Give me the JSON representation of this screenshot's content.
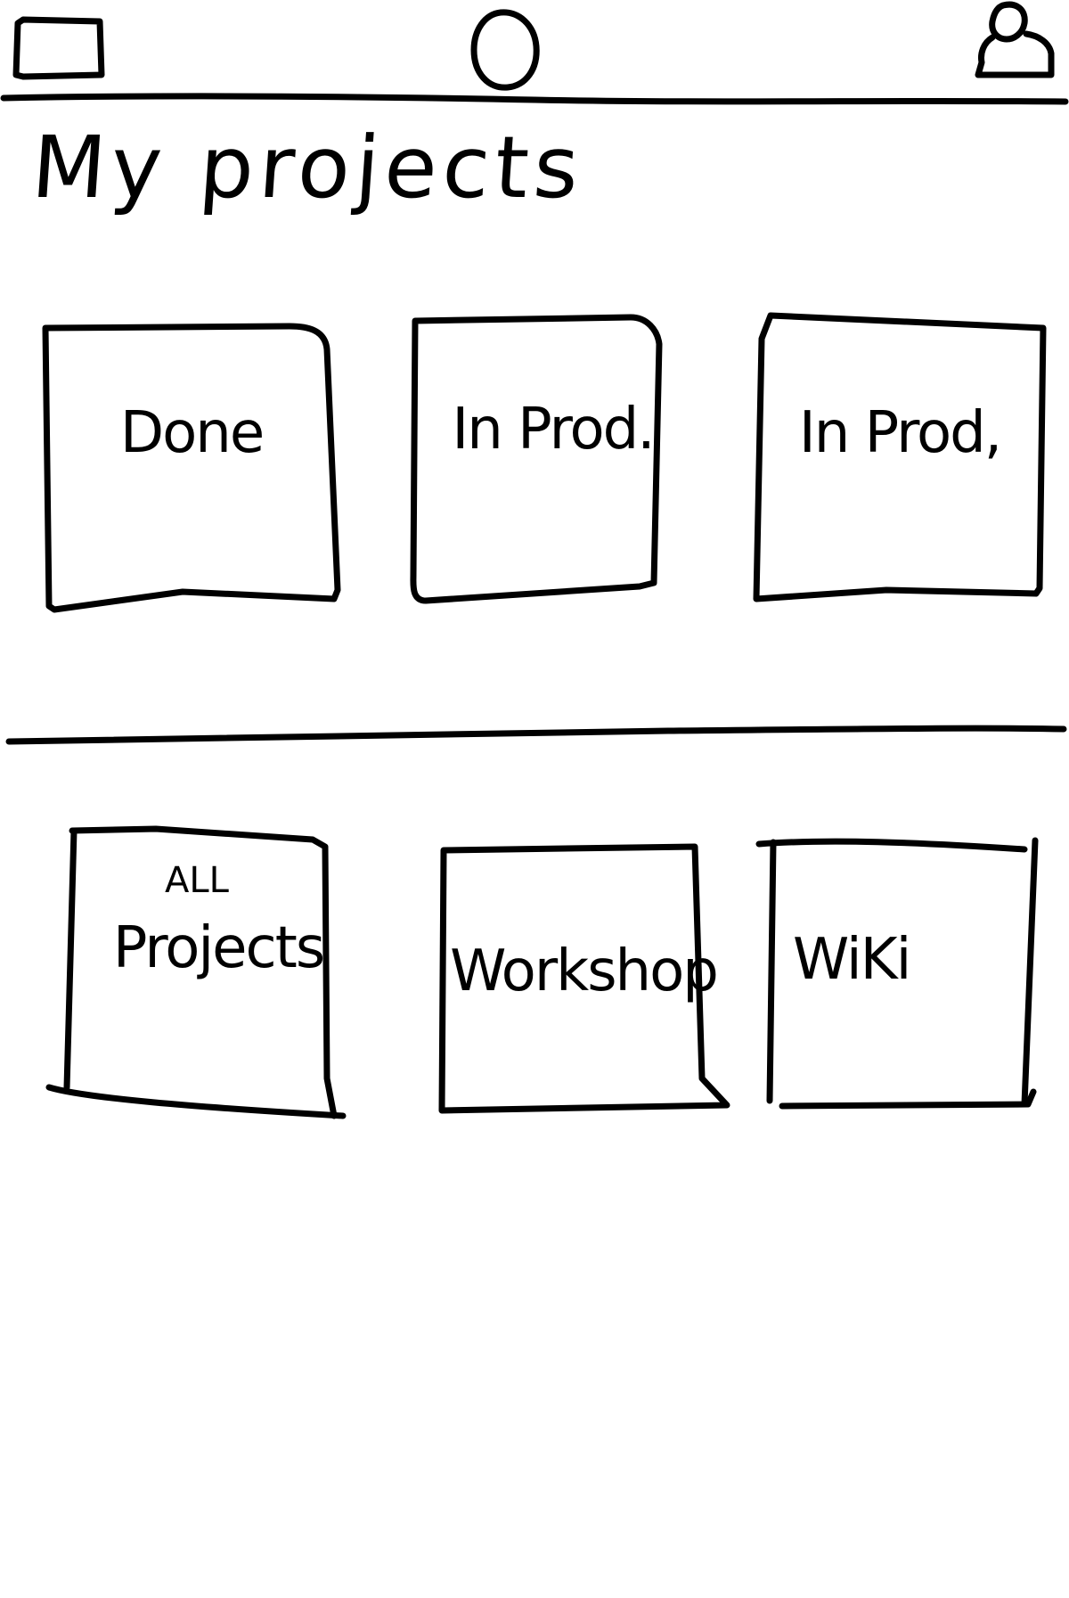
{
  "header": {
    "menu_icon": "rectangle-menu-icon",
    "home_icon": "circle-home-icon",
    "profile_icon": "user-profile-icon"
  },
  "page_title": "My projects",
  "my_projects": [
    {
      "label": "Done"
    },
    {
      "label": "In Prod."
    },
    {
      "label": "In Prod,"
    }
  ],
  "bottom_tiles": [
    {
      "label_top": "ALL",
      "label": "Projects"
    },
    {
      "label": "Workshop"
    },
    {
      "label": "WiKi"
    }
  ]
}
